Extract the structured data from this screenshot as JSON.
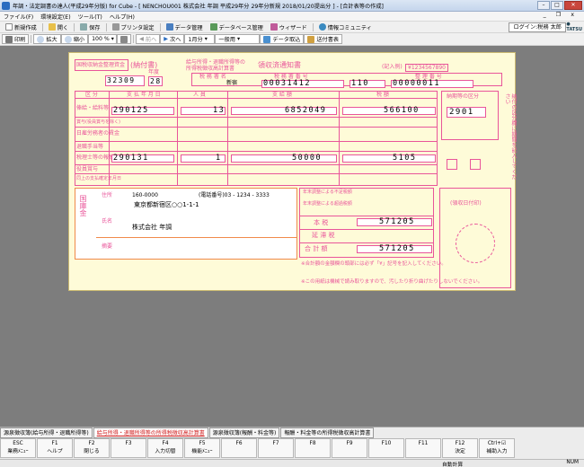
{
  "window": {
    "title": "年調・法定調書の達人(平成29年分版) for Cube - [ NENCHOU001 株式会社 年調 平成29年分 29年分新規 2018/01/20提出分 ] - [合計表等の作成]"
  },
  "menu": [
    "ファイル(F)",
    "環境設定(E)",
    "ツール(T)",
    "ヘルプ(H)"
  ],
  "toolbar1": [
    "新規作成",
    "開く",
    "保存",
    "プリンタ設定",
    "データ管理",
    "データベース管理",
    "ウィザード",
    "情報コミュニティ"
  ],
  "login": "ログイン:税務 太郎",
  "toolbar2": {
    "print": "印刷",
    "zoom": "拡大",
    "shrink": "縮小",
    "zoom_value": "100 %",
    "prev": "前へ",
    "next": "次へ",
    "period": "1月分",
    "type": "一般用",
    "import": "データ取込",
    "submit": "送付書表"
  },
  "form": {
    "stamp": "国税収納金整理資金",
    "notice": "(納付書)",
    "year_label": "年度",
    "year": "28",
    "code": "32309",
    "title_small1": "給与所得・退職所得等の",
    "title_small2": "所得税徴収高計算書",
    "receipt": "領収済通知書",
    "section_tax_office": "税 務 署 名",
    "section_tax_office_no": "税 務 署 番 号",
    "section_wage_no": "整 理 番 号",
    "tax_office_name": "新宿",
    "tax_office_no": "00031412",
    "section_code": "110",
    "seiri_no": "00000011",
    "col_kubun": "区 分",
    "col_date": "支 払 年 月 日",
    "col_people": "人 員",
    "col_amount": "支 給 額",
    "col_tax": "税 額",
    "rows": [
      {
        "label": "俸給・給料等",
        "date": "290125",
        "people": "13",
        "amount": "6852049",
        "tax": "566100"
      },
      {
        "label": "賞与(役員賞与を除く)",
        "date": "",
        "people": "",
        "amount": "",
        "tax": ""
      },
      {
        "label": "日雇労務者の賃金",
        "date": "",
        "people": "",
        "amount": "",
        "tax": ""
      },
      {
        "label": "退職手当等",
        "date": "",
        "people": "",
        "amount": "",
        "tax": ""
      },
      {
        "label": "税理士等の報酬",
        "date": "290131",
        "people": "1",
        "amount": "50000",
        "tax": "5105"
      },
      {
        "label": "役員賞与",
        "date": "",
        "people": "",
        "amount": "",
        "tax": ""
      },
      {
        "label": "同上の支払確定年月日",
        "date": "",
        "people": "",
        "amount": "",
        "tax": ""
      }
    ],
    "nofu_kubun_title": "納期等の区分",
    "nofu_date": "2901",
    "side_vertical": "納付の区分欄に期間を記入してください",
    "payer_label": "納付者",
    "addr_label": "住所",
    "zip": "160-0000",
    "tel": "(電話番号)03 - 1234 - 3333",
    "address": "東京都新宿区○○1-1-1",
    "name_label": "氏名",
    "name": "株式会社 年調",
    "note_label": "摘要",
    "right_labels": [
      "本 税",
      "延 滞 税",
      "合 計 額"
    ],
    "honzei": "571205",
    "gokei": "571205",
    "uketsuke": "(領収日付印)",
    "koku": "国庫金",
    "footnote1": "※合計額の金額欄の頭部には必ず「¥」記号を記入してください。",
    "footnote2": "※この用紙は機械で読み取りますので、汚したり折り曲げたりしないでください。",
    "fuzokutax": [
      "年末調整による不足税額",
      "年末調整による超過税額"
    ]
  },
  "tabs": [
    "源泉徴収簿(給与所得・退職所得等)",
    "給与所得・退職所得等の所得税徴収高計算書",
    "源泉徴収簿(報酬・料金等)",
    "報酬・料金等の所得税徴収高計算書"
  ],
  "fkeys": [
    {
      "k": "ESC",
      "l": "業務ﾒﾆｭｰ"
    },
    {
      "k": "F1",
      "l": "ヘルプ"
    },
    {
      "k": "F2",
      "l": "閉じる"
    },
    {
      "k": "F3",
      "l": ""
    },
    {
      "k": "F4",
      "l": "入力切替"
    },
    {
      "k": "F5",
      "l": "機能ﾒﾆｭｰ"
    },
    {
      "k": "F6",
      "l": ""
    },
    {
      "k": "F7",
      "l": ""
    },
    {
      "k": "F8",
      "l": ""
    },
    {
      "k": "F9",
      "l": ""
    },
    {
      "k": "F10",
      "l": ""
    },
    {
      "k": "F11",
      "l": ""
    },
    {
      "k": "F12",
      "l": "決定"
    },
    {
      "k": "Ctrl+☑",
      "l": "補助入力"
    }
  ],
  "status": {
    "mode": "自動計算",
    "num": "NUM"
  }
}
